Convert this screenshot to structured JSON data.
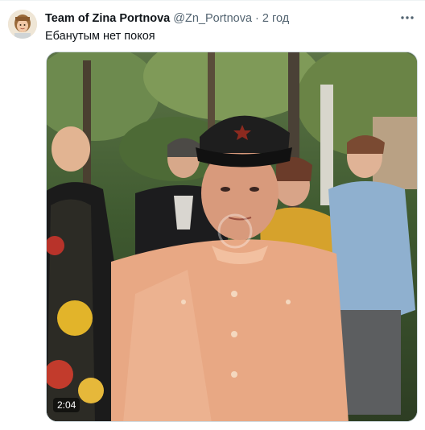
{
  "tweet": {
    "display_name": "Team of Zina Portnova",
    "handle": "@Zn_Portnova",
    "separator": "·",
    "time": "2 год",
    "text": "Ебанутым нет покоя",
    "more_icon": "more-horizontal-icon"
  },
  "video": {
    "duration": "2:04"
  },
  "colors": {
    "text_primary": "#0f1419",
    "text_secondary": "#536471",
    "border": "#cfd9de"
  }
}
